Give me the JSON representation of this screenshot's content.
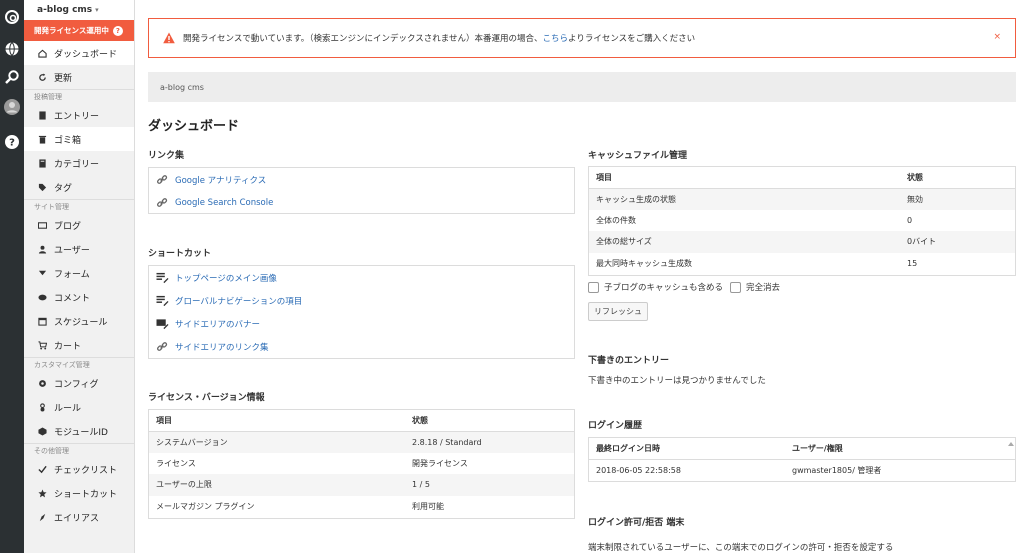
{
  "rail": {
    "icons": [
      "logo-icon",
      "globe-icon",
      "search-icon",
      "avatar",
      "help-icon"
    ]
  },
  "sidebar": {
    "brand": "a-blog cms",
    "dev_banner": "開発ライセンス運用中",
    "items_top": [
      {
        "label": "ダッシュボード",
        "icon": "home-icon"
      },
      {
        "label": "更新",
        "icon": "refresh-icon"
      }
    ],
    "sections": [
      {
        "label": "投稿管理",
        "items": [
          {
            "label": "エントリー",
            "icon": "document-icon"
          },
          {
            "label": "ゴミ箱",
            "icon": "trash-icon"
          },
          {
            "label": "カテゴリー",
            "icon": "folder-icon"
          },
          {
            "label": "タグ",
            "icon": "tag-icon"
          }
        ]
      },
      {
        "label": "サイト管理",
        "items": [
          {
            "label": "ブログ",
            "icon": "blog-icon"
          },
          {
            "label": "ユーザー",
            "icon": "user-icon"
          },
          {
            "label": "フォーム",
            "icon": "form-icon"
          },
          {
            "label": "コメント",
            "icon": "comment-icon"
          },
          {
            "label": "スケジュール",
            "icon": "calendar-icon"
          },
          {
            "label": "カート",
            "icon": "cart-icon"
          }
        ]
      },
      {
        "label": "カスタマイズ管理",
        "items": [
          {
            "label": "コンフィグ",
            "icon": "gear-icon"
          },
          {
            "label": "ルール",
            "icon": "rule-icon"
          },
          {
            "label": "モジュールID",
            "icon": "module-icon"
          }
        ]
      },
      {
        "label": "その他管理",
        "items": [
          {
            "label": "チェックリスト",
            "icon": "check-icon"
          },
          {
            "label": "ショートカット",
            "icon": "star-icon"
          },
          {
            "label": "エイリアス",
            "icon": "alias-icon"
          }
        ]
      }
    ]
  },
  "alert": {
    "text_before": "開発ライセンスで動いています。（検索エンジンにインデックスされません）本番運用の場合、",
    "link": "こちら",
    "text_after": "よりライセンスをご購入ください",
    "close": "×"
  },
  "site_bar": "a-blog cms",
  "page_title": "ダッシュボード",
  "links": {
    "title": "リンク集",
    "items": [
      "Google アナリティクス",
      "Google Search Console"
    ]
  },
  "shortcuts": {
    "title": "ショートカット",
    "items": [
      "トップページのメイン画像",
      "グローバルナビゲーションの項目",
      "サイドエリアのバナー",
      "サイドエリアのリンク集"
    ]
  },
  "license": {
    "title": "ライセンス・バージョン情報",
    "headers": [
      "項目",
      "状態"
    ],
    "rows": [
      [
        "システムバージョン",
        "2.8.18 / Standard"
      ],
      [
        "ライセンス",
        "開発ライセンス"
      ],
      [
        "ユーザーの上限",
        "1 / 5"
      ],
      [
        "メールマガジン プラグイン",
        "利用可能"
      ]
    ]
  },
  "cache": {
    "title": "キャッシュファイル管理",
    "headers": [
      "項目",
      "状態"
    ],
    "rows": [
      [
        "キャッシュ生成の状態",
        "無効"
      ],
      [
        "全体の件数",
        "0"
      ],
      [
        "全体の総サイズ",
        "0バイト"
      ],
      [
        "最大同時キャッシュ生成数",
        "15"
      ]
    ],
    "check_child": "子ブログのキャッシュも含める",
    "check_full": "完全消去",
    "refresh": "リフレッシュ"
  },
  "drafts": {
    "title": "下書きのエントリー",
    "text": "下書き中のエントリーは見つかりませんでした"
  },
  "login_history": {
    "title": "ログイン履歴",
    "headers": [
      "最終ログイン日時",
      "ユーザー/権限"
    ],
    "rows": [
      [
        "2018-06-05 22:58:58",
        "gwmaster1805/ 管理者"
      ]
    ]
  },
  "login_permit": {
    "title": "ログイン許可/拒否 端末",
    "text": "端末制限されているユーザーに、この端末でのログインの許可・拒否を設定する"
  },
  "colors": {
    "accent": "#f15c3f",
    "rail": "#2b3033",
    "link": "#2a6bb5"
  }
}
